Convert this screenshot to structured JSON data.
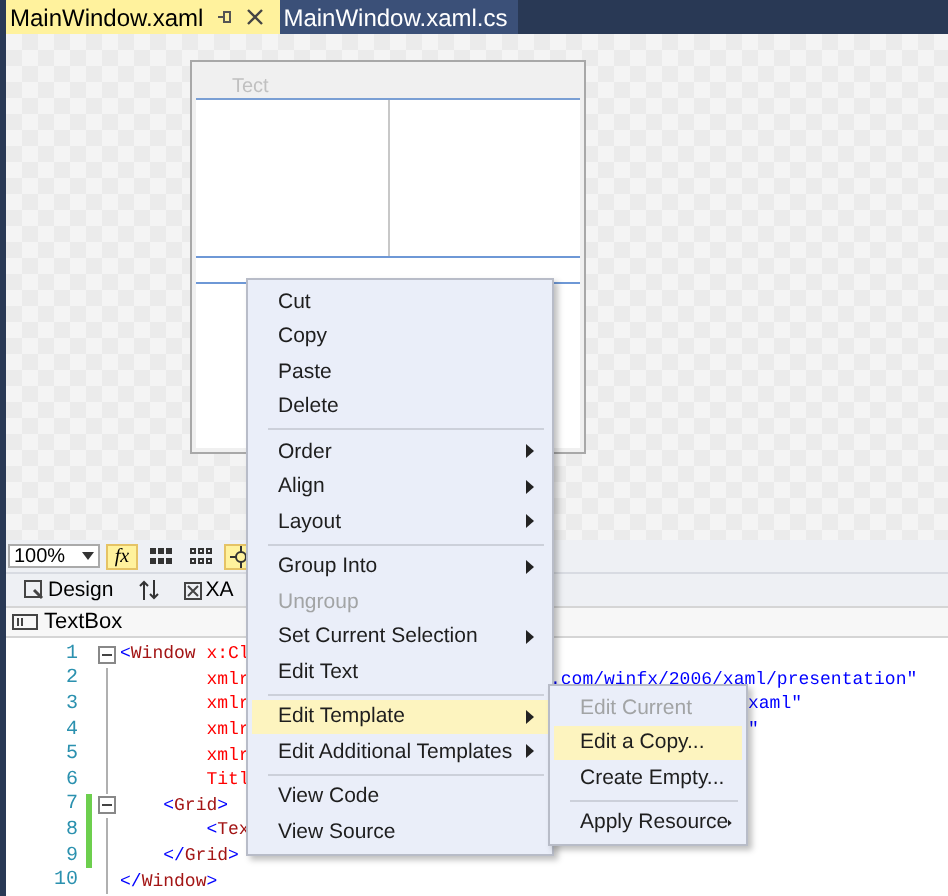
{
  "tabs": [
    {
      "label": "MainWindow.xaml",
      "selected": true
    },
    {
      "label": "MainWindow.xaml.cs",
      "selected": false
    }
  ],
  "designer": {
    "window_title": "Tect"
  },
  "toolbar": {
    "zoom": "100%",
    "buttons": [
      {
        "kind": "fx",
        "label": "fx",
        "on": true
      },
      {
        "kind": "grid",
        "on": false
      },
      {
        "kind": "dots",
        "on": false
      },
      {
        "kind": "snap",
        "on": true
      }
    ]
  },
  "view_tabs": [
    {
      "kind": "design",
      "label": "Design"
    },
    {
      "kind": "swap"
    },
    {
      "kind": "xaml",
      "label": "XA"
    }
  ],
  "breadcrumb": "TextBox",
  "code_lines": [
    {
      "number": "1",
      "text": "<Window x:Cl",
      "fold": true,
      "changed": false
    },
    {
      "number": "2",
      "text": "        xmlr",
      "fold": false,
      "changed": false,
      "after": ".com/winfx/2006/xaml/presentation\""
    },
    {
      "number": "3",
      "text": "        xmlr",
      "fold": false,
      "changed": false,
      "after": "xaml\""
    },
    {
      "number": "4",
      "text": "        xmlr",
      "fold": false,
      "changed": false,
      "after": "\""
    },
    {
      "number": "5",
      "text": "        xmlr",
      "fold": false,
      "changed": false
    },
    {
      "number": "6",
      "text": "        Titl",
      "fold": false,
      "changed": false
    },
    {
      "number": "7",
      "text": "    <Grid>",
      "fold": true,
      "changed": true
    },
    {
      "number": "8",
      "text": "        <Tex",
      "fold": false,
      "changed": true
    },
    {
      "number": "9",
      "text": "    </Grid>",
      "fold": false,
      "changed": true
    },
    {
      "number": "10",
      "text": "</Window>",
      "fold": false,
      "changed": false
    }
  ],
  "context_menu": {
    "items": [
      {
        "kind": "item",
        "label": "Cut",
        "disabled": false,
        "submenu": false,
        "selected": false
      },
      {
        "kind": "item",
        "label": "Copy",
        "disabled": false,
        "submenu": false,
        "selected": false
      },
      {
        "kind": "item",
        "label": "Paste",
        "disabled": false,
        "submenu": false,
        "selected": false
      },
      {
        "kind": "item",
        "label": "Delete",
        "disabled": false,
        "submenu": false,
        "selected": false
      },
      {
        "kind": "separator"
      },
      {
        "kind": "item",
        "label": "Order",
        "disabled": false,
        "submenu": true,
        "selected": false
      },
      {
        "kind": "item",
        "label": "Align",
        "disabled": false,
        "submenu": true,
        "selected": false
      },
      {
        "kind": "item",
        "label": "Layout",
        "disabled": false,
        "submenu": true,
        "selected": false
      },
      {
        "kind": "separator"
      },
      {
        "kind": "item",
        "label": "Group Into",
        "disabled": false,
        "submenu": true,
        "selected": false
      },
      {
        "kind": "item",
        "label": "Ungroup",
        "disabled": true,
        "submenu": false,
        "selected": false
      },
      {
        "kind": "item",
        "label": "Set Current Selection",
        "disabled": false,
        "submenu": true,
        "selected": false
      },
      {
        "kind": "item",
        "label": "Edit Text",
        "disabled": false,
        "submenu": false,
        "selected": false
      },
      {
        "kind": "separator"
      },
      {
        "kind": "item",
        "label": "Edit Template",
        "disabled": false,
        "submenu": true,
        "selected": true
      },
      {
        "kind": "item",
        "label": "Edit Additional Templates",
        "disabled": false,
        "submenu": true,
        "selected": false
      },
      {
        "kind": "separator"
      },
      {
        "kind": "item",
        "label": "View Code",
        "disabled": false,
        "submenu": false,
        "selected": false
      },
      {
        "kind": "item",
        "label": "View Source",
        "disabled": false,
        "submenu": false,
        "selected": false
      }
    ]
  },
  "submenu": {
    "items": [
      {
        "kind": "item",
        "label": "Edit Current",
        "disabled": true,
        "submenu": false,
        "selected": false
      },
      {
        "kind": "item",
        "label": "Edit a Copy...",
        "disabled": false,
        "submenu": false,
        "selected": true
      },
      {
        "kind": "item",
        "label": "Create Empty...",
        "disabled": false,
        "submenu": false,
        "selected": false
      },
      {
        "kind": "separator"
      },
      {
        "kind": "item",
        "label": "Apply Resource",
        "disabled": false,
        "submenu": true,
        "selected": false
      }
    ]
  }
}
